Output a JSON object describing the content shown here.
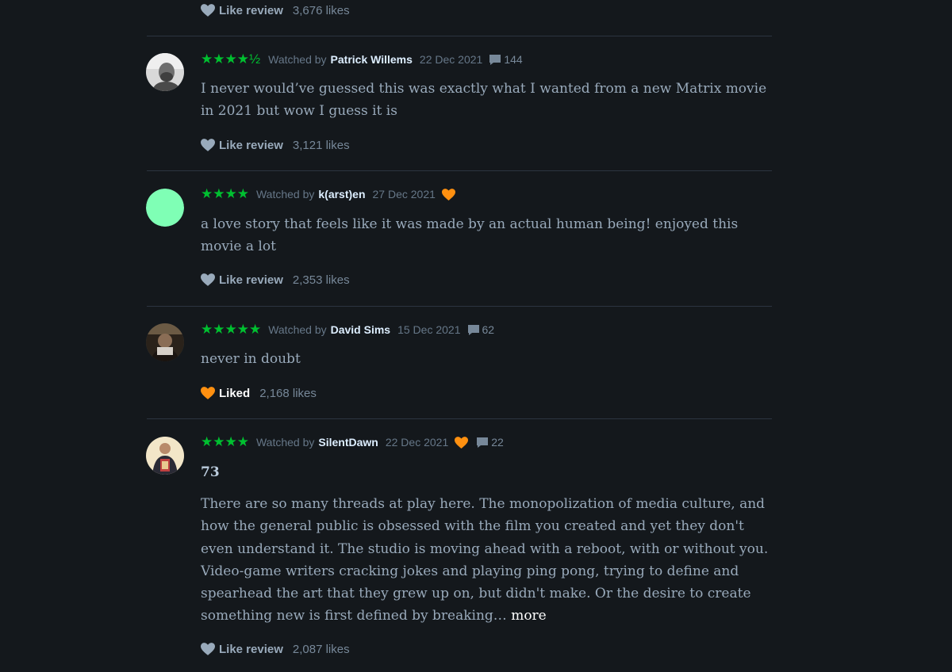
{
  "reviews": [
    {
      "like_label": "Like review",
      "likes": "3,676 likes"
    },
    {
      "rating": "★★★★½",
      "watched_by_label": "Watched by",
      "author": "Patrick Willems",
      "date": "22 Dec 2021",
      "comments": "144",
      "text": "I never would’ve guessed this was exactly what I wanted from a new Matrix movie in 2021 but wow I guess it is",
      "like_label": "Like review",
      "likes": "3,121 likes"
    },
    {
      "rating": "★★★★",
      "watched_by_label": "Watched by",
      "author": "k(arst)en",
      "date": "27 Dec 2021",
      "avatar_color": "#7fffb5",
      "text": "a love story that feels like it was made by an actual human being! enjoyed this movie a lot",
      "like_label": "Like review",
      "likes": "2,353 likes"
    },
    {
      "rating": "★★★★★",
      "watched_by_label": "Watched by",
      "author": "David Sims",
      "date": "15 Dec 2021",
      "comments": "62",
      "text": "never in doubt",
      "like_label": "Liked",
      "likes": "2,168 likes"
    },
    {
      "rating": "★★★★",
      "watched_by_label": "Watched by",
      "author": "SilentDawn",
      "date": "22 Dec 2021",
      "comments": "22",
      "heading": "73",
      "text": "There are so many threads at play here. The monopolization of media culture, and how the general public is obsessed with the film you created and yet they don't even understand it. The studio is moving ahead with a reboot, with or without you. Video-game writers cracking jokes and playing ping pong, trying to define and spearhead the art that they grew up on, but didn't make. Or the desire to create something new is first defined by breaking…",
      "more_label": "more",
      "like_label": "Like review",
      "likes": "2,087 likes"
    }
  ],
  "colors": {
    "background": "#14181c",
    "star_green": "#00c030",
    "liked_orange": "#ff9010",
    "divider": "#2c3440",
    "text": "#99aabb",
    "author": "#ddeeff"
  },
  "icons": {
    "like": "heart-icon",
    "liked": "heart-icon-filled-orange",
    "comments": "speech-bubble-icon"
  }
}
